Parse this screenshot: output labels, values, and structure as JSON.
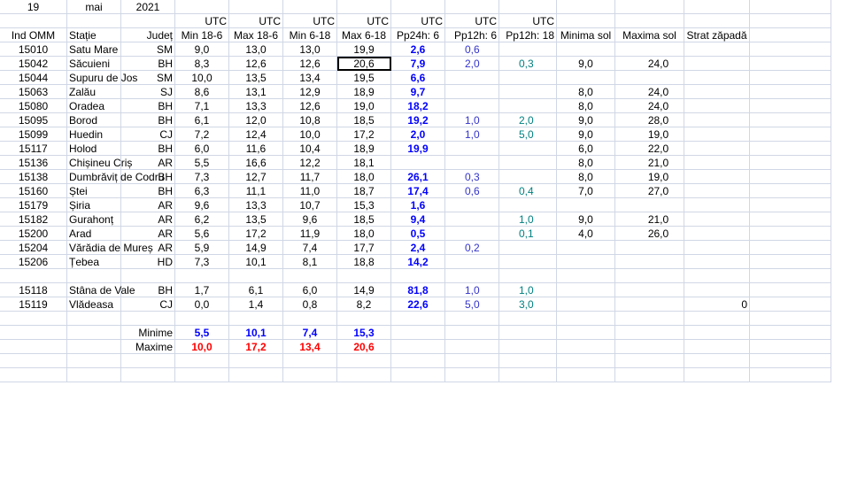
{
  "title_row": {
    "day": "19",
    "month": "mai",
    "year": "2021"
  },
  "utc_label": "UTC",
  "headers": {
    "ind": "Ind OMM",
    "statie": "Stație",
    "judet": "Județ",
    "min18_6": "Min 18-6",
    "max18_6": "Max 18-6",
    "min6_18": "Min 6-18",
    "max6_18": "Max 6-18",
    "pp24": "Pp24h: 6",
    "pp12_6": "Pp12h: 6",
    "pp12_18": "Pp12h: 18",
    "min_sol": "Minima sol",
    "max_sol": "Maxima sol",
    "zapada": "Strat zăpadă"
  },
  "rows": [
    {
      "ind": "15010",
      "statie": "Satu Mare",
      "judet": "SM",
      "min18_6": "9,0",
      "max18_6": "13,0",
      "min6_18": "13,0",
      "max6_18": "19,9",
      "pp24": "2,6",
      "pp12_6": "0,6",
      "pp12_18": "",
      "min_sol": "",
      "max_sol": "",
      "zapada": ""
    },
    {
      "ind": "15042",
      "statie": "Săcuieni",
      "judet": "BH",
      "min18_6": "8,3",
      "max18_6": "12,6",
      "min6_18": "12,6",
      "max6_18": "20,6",
      "pp24": "7,9",
      "pp12_6": "2,0",
      "pp12_18": "0,3",
      "min_sol": "9,0",
      "max_sol": "24,0",
      "zapada": ""
    },
    {
      "ind": "15044",
      "statie": "Supuru de Jos",
      "judet": "SM",
      "min18_6": "10,0",
      "max18_6": "13,5",
      "min6_18": "13,4",
      "max6_18": "19,5",
      "pp24": "6,6",
      "pp12_6": "",
      "pp12_18": "",
      "min_sol": "",
      "max_sol": "",
      "zapada": ""
    },
    {
      "ind": "15063",
      "statie": "Zalău",
      "judet": "SJ",
      "min18_6": "8,6",
      "max18_6": "13,1",
      "min6_18": "12,9",
      "max6_18": "18,9",
      "pp24": "9,7",
      "pp12_6": "",
      "pp12_18": "",
      "min_sol": "8,0",
      "max_sol": "24,0",
      "zapada": ""
    },
    {
      "ind": "15080",
      "statie": "Oradea",
      "judet": "BH",
      "min18_6": "7,1",
      "max18_6": "13,3",
      "min6_18": "12,6",
      "max6_18": "19,0",
      "pp24": "18,2",
      "pp12_6": "",
      "pp12_18": "",
      "min_sol": "8,0",
      "max_sol": "24,0",
      "zapada": ""
    },
    {
      "ind": "15095",
      "statie": "Borod",
      "judet": "BH",
      "min18_6": "6,1",
      "max18_6": "12,0",
      "min6_18": "10,8",
      "max6_18": "18,5",
      "pp24": "19,2",
      "pp12_6": "1,0",
      "pp12_18": "2,0",
      "min_sol": "9,0",
      "max_sol": "28,0",
      "zapada": ""
    },
    {
      "ind": "15099",
      "statie": "Huedin",
      "judet": "CJ",
      "min18_6": "7,2",
      "max18_6": "12,4",
      "min6_18": "10,0",
      "max6_18": "17,2",
      "pp24": "2,0",
      "pp12_6": "1,0",
      "pp12_18": "5,0",
      "min_sol": "9,0",
      "max_sol": "19,0",
      "zapada": ""
    },
    {
      "ind": "15117",
      "statie": "Holod",
      "judet": "BH",
      "min18_6": "6,0",
      "max18_6": "11,6",
      "min6_18": "10,4",
      "max6_18": "18,9",
      "pp24": "19,9",
      "pp12_6": "",
      "pp12_18": "",
      "min_sol": "6,0",
      "max_sol": "22,0",
      "zapada": ""
    },
    {
      "ind": "15136",
      "statie": "Chișineu   Criș",
      "judet": "AR",
      "min18_6": "5,5",
      "max18_6": "16,6",
      "min6_18": "12,2",
      "max6_18": "18,1",
      "pp24": "",
      "pp12_6": "",
      "pp12_18": "",
      "min_sol": "8,0",
      "max_sol": "21,0",
      "zapada": ""
    },
    {
      "ind": "15138",
      "statie": "Dumbrăviț  de Codru",
      "judet": "BH",
      "min18_6": "7,3",
      "max18_6": "12,7",
      "min6_18": "11,7",
      "max6_18": "18,0",
      "pp24": "26,1",
      "pp12_6": "0,3",
      "pp12_18": "",
      "min_sol": "8,0",
      "max_sol": "19,0",
      "zapada": ""
    },
    {
      "ind": "15160",
      "statie": "Ștei",
      "judet": "BH",
      "min18_6": "6,3",
      "max18_6": "11,1",
      "min6_18": "11,0",
      "max6_18": "18,7",
      "pp24": "17,4",
      "pp12_6": "0,6",
      "pp12_18": "0,4",
      "min_sol": "7,0",
      "max_sol": "27,0",
      "zapada": ""
    },
    {
      "ind": "15179",
      "statie": "Șiria",
      "judet": "AR",
      "min18_6": "9,6",
      "max18_6": "13,3",
      "min6_18": "10,7",
      "max6_18": "15,3",
      "pp24": "1,6",
      "pp12_6": "",
      "pp12_18": "",
      "min_sol": "",
      "max_sol": "",
      "zapada": ""
    },
    {
      "ind": "15182",
      "statie": "Gurahonț",
      "judet": "AR",
      "min18_6": "6,2",
      "max18_6": "13,5",
      "min6_18": "9,6",
      "max6_18": "18,5",
      "pp24": "9,4",
      "pp12_6": "",
      "pp12_18": "1,0",
      "min_sol": "9,0",
      "max_sol": "21,0",
      "zapada": ""
    },
    {
      "ind": "15200",
      "statie": "Arad",
      "judet": "AR",
      "min18_6": "5,6",
      "max18_6": "17,2",
      "min6_18": "11,9",
      "max6_18": "18,0",
      "pp24": "0,5",
      "pp12_6": "",
      "pp12_18": "0,1",
      "min_sol": "4,0",
      "max_sol": "26,0",
      "zapada": ""
    },
    {
      "ind": "15204",
      "statie": "Vărădia de Mureș",
      "judet": "AR",
      "min18_6": "5,9",
      "max18_6": "14,9",
      "min6_18": "7,4",
      "max6_18": "17,7",
      "pp24": "2,4",
      "pp12_6": "0,2",
      "pp12_18": "",
      "min_sol": "",
      "max_sol": "",
      "zapada": ""
    },
    {
      "ind": "15206",
      "statie": "Țebea",
      "judet": "HD",
      "min18_6": "7,3",
      "max18_6": "10,1",
      "min6_18": "8,1",
      "max6_18": "18,8",
      "pp24": "14,2",
      "pp12_6": "",
      "pp12_18": "",
      "min_sol": "",
      "max_sol": "",
      "zapada": ""
    },
    {
      "ind": "",
      "statie": "",
      "judet": "",
      "min18_6": "",
      "max18_6": "",
      "min6_18": "",
      "max6_18": "",
      "pp24": "",
      "pp12_6": "",
      "pp12_18": "",
      "min_sol": "",
      "max_sol": "",
      "zapada": ""
    },
    {
      "ind": "15118",
      "statie": "Stâna de Vale",
      "judet": "BH",
      "min18_6": "1,7",
      "max18_6": "6,1",
      "min6_18": "6,0",
      "max6_18": "14,9",
      "pp24": "81,8",
      "pp12_6": "1,0",
      "pp12_18": "1,0",
      "min_sol": "",
      "max_sol": "",
      "zapada": ""
    },
    {
      "ind": "15119",
      "statie": "Vlădeasa",
      "judet": "CJ",
      "min18_6": "0,0",
      "max18_6": "1,4",
      "min6_18": "0,8",
      "max6_18": "8,2",
      "pp24": "22,6",
      "pp12_6": "5,0",
      "pp12_18": "3,0",
      "min_sol": "",
      "max_sol": "",
      "zapada": "0"
    }
  ],
  "summary": {
    "minime": {
      "label": "Minime",
      "min18_6": "5,5",
      "max18_6": "10,1",
      "min6_18": "7,4",
      "max6_18": "15,3"
    },
    "maxime": {
      "label": "Maxime",
      "min18_6": "10,0",
      "max18_6": "17,2",
      "min6_18": "13,4",
      "max6_18": "20,6"
    }
  },
  "colors": {
    "grid": "#d0d7e5",
    "pp24": "#0000ff",
    "minime": "#0000ff",
    "maxime": "#ff0000",
    "pp12_6": "#3333cc",
    "pp12_18": "#008080"
  }
}
